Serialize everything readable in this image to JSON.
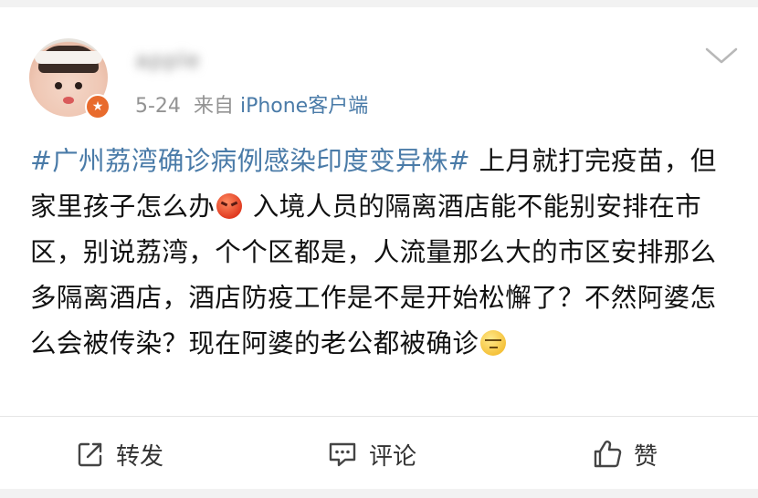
{
  "header": {
    "username": "apple",
    "date": "5-24",
    "source_prefix": "来自",
    "source": "iPhone客户端",
    "avatar_badge_icon": "star-badge-icon"
  },
  "post": {
    "hashtag": "#广州荔湾确诊病例感染印度变异株#",
    "text_part1": "上月就打完疫苗，但家里孩子怎么办",
    "emoji1": "angry-face-emoji",
    "text_part2": "入境人员的隔离酒店能不能别安排在市区，别说荔湾，个个区都是，人流量那么大的市区安排那么多隔离酒店，酒店防疫工作是不是开始松懈了？不然阿婆怎么会被传染？现在阿婆的老公都被确诊",
    "emoji2": "meh-face-emoji"
  },
  "actions": {
    "forward_label": "转发",
    "comment_label": "评论",
    "like_label": "赞"
  },
  "colors": {
    "link": "#4a7ba8",
    "meta": "#939393",
    "text": "#111111",
    "badge": "#e86b2d"
  }
}
